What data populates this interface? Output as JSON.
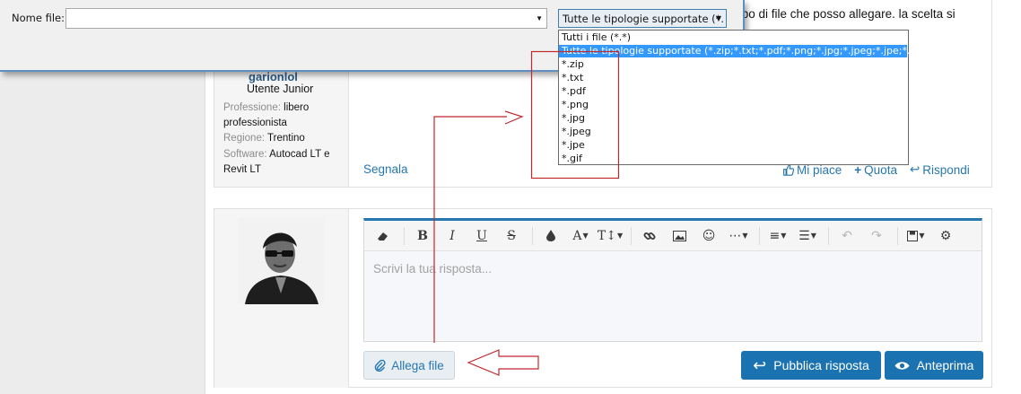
{
  "dialog": {
    "filename_label": "Nome file:",
    "filename_value": "",
    "filetype_selected": "Tutte le tipologie supportate (*.",
    "filetype_options": [
      "Tutti i file (*.*)",
      "Tutte le tipologie supportate (*.zip;*.txt;*.pdf;*.png;*.jpg;*.jpeg;*.jpe;*.gif)",
      "*.zip",
      "*.txt",
      "*.pdf",
      "*.png",
      "*.jpg",
      "*.jpeg",
      "*.jpe",
      "*.gif"
    ],
    "selected_index": 1
  },
  "post": {
    "text_lines": [
      "tipo di file che posso allegare. la scelta si",
      "…"
    ],
    "username": "garionlol",
    "user_title": "Utente Junior",
    "profession_label": "Professione:",
    "profession_value": "libero professionista",
    "region_label": "Regione:",
    "region_value": "Trentino",
    "software_label": "Software:",
    "software_value": "Autocad LT e Revit LT",
    "report": "Segnala",
    "like": "Mi piace",
    "quote": "Quota",
    "reply": "Rispondi"
  },
  "editor": {
    "placeholder": "Scrivi la tua risposta...",
    "toolbar_icons": [
      "eraser-icon",
      "bold-icon",
      "italic-icon",
      "underline-icon",
      "strikethrough-icon",
      "text-color-icon",
      "font-family-icon",
      "font-size-icon",
      "link-icon",
      "image-icon",
      "smiley-icon",
      "more-icon",
      "align-icon",
      "list-icon",
      "undo-icon",
      "redo-icon",
      "save-draft-icon",
      "settings-icon"
    ],
    "attach_label": "Allega file",
    "publish_label": "Pubblica risposta",
    "preview_label": "Anteprima"
  },
  "colors": {
    "accent": "#2577b1",
    "button_blue": "#1a73b0",
    "selection_blue": "#3399ff",
    "annotation_red": "#c0282d"
  }
}
